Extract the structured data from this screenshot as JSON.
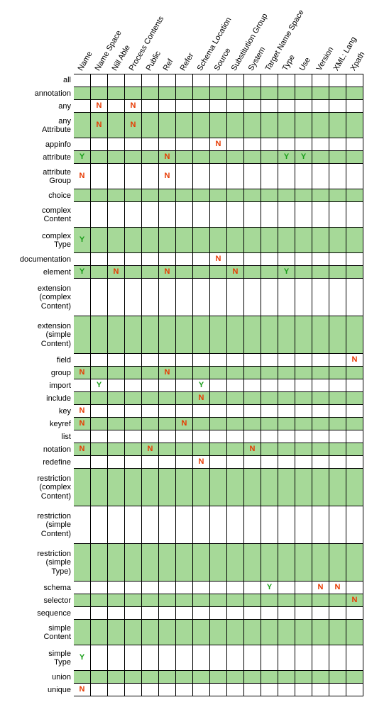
{
  "chart_data": {
    "type": "table",
    "title": "",
    "columns": [
      "Name",
      "Name Space",
      "Nill Able",
      "Process Contents",
      "Public",
      "Ref",
      "Refer",
      "Schema Location",
      "Source",
      "Substitution Group",
      "System",
      "Target Name Space",
      "Type",
      "Use",
      "Version",
      "XML: Lang",
      "Xpath"
    ],
    "rows": [
      {
        "label": "all",
        "shaded": false,
        "cells": [
          "",
          "",
          "",
          "",
          "",
          "",
          "",
          "",
          "",
          "",
          "",
          "",
          "",
          "",
          "",
          "",
          ""
        ]
      },
      {
        "label": "annotation",
        "shaded": true,
        "cells": [
          "",
          "",
          "",
          "",
          "",
          "",
          "",
          "",
          "",
          "",
          "",
          "",
          "",
          "",
          "",
          "",
          ""
        ]
      },
      {
        "label": "any",
        "shaded": false,
        "cells": [
          "",
          "N",
          "",
          "N",
          "",
          "",
          "",
          "",
          "",
          "",
          "",
          "",
          "",
          "",
          "",
          "",
          ""
        ]
      },
      {
        "label": "any\nAttribute",
        "shaded": true,
        "lines": 2,
        "cells": [
          "",
          "N",
          "",
          "N",
          "",
          "",
          "",
          "",
          "",
          "",
          "",
          "",
          "",
          "",
          "",
          "",
          ""
        ]
      },
      {
        "label": "appinfo",
        "shaded": false,
        "cells": [
          "",
          "",
          "",
          "",
          "",
          "",
          "",
          "",
          "N",
          "",
          "",
          "",
          "",
          "",
          "",
          "",
          ""
        ]
      },
      {
        "label": "attribute",
        "shaded": true,
        "cells": [
          "Y",
          "",
          "",
          "",
          "",
          "N",
          "",
          "",
          "",
          "",
          "",
          "",
          "Y",
          "Y",
          "",
          "",
          ""
        ]
      },
      {
        "label": "attribute\nGroup",
        "shaded": false,
        "lines": 2,
        "cells": [
          "N",
          "",
          "",
          "",
          "",
          "N",
          "",
          "",
          "",
          "",
          "",
          "",
          "",
          "",
          "",
          "",
          ""
        ]
      },
      {
        "label": "choice",
        "shaded": true,
        "cells": [
          "",
          "",
          "",
          "",
          "",
          "",
          "",
          "",
          "",
          "",
          "",
          "",
          "",
          "",
          "",
          "",
          ""
        ]
      },
      {
        "label": "complex\nContent",
        "shaded": false,
        "lines": 2,
        "cells": [
          "",
          "",
          "",
          "",
          "",
          "",
          "",
          "",
          "",
          "",
          "",
          "",
          "",
          "",
          "",
          "",
          ""
        ]
      },
      {
        "label": "complex\nType",
        "shaded": true,
        "lines": 2,
        "cells": [
          "Y",
          "",
          "",
          "",
          "",
          "",
          "",
          "",
          "",
          "",
          "",
          "",
          "",
          "",
          "",
          "",
          ""
        ]
      },
      {
        "label": "documentation",
        "shaded": false,
        "cells": [
          "",
          "",
          "",
          "",
          "",
          "",
          "",
          "",
          "N",
          "",
          "",
          "",
          "",
          "",
          "",
          "",
          ""
        ]
      },
      {
        "label": "element",
        "shaded": true,
        "cells": [
          "Y",
          "",
          "N",
          "",
          "",
          "N",
          "",
          "",
          "",
          "N",
          "",
          "",
          "Y",
          "",
          "",
          "",
          ""
        ]
      },
      {
        "label": "extension\n(complex\nContent)",
        "shaded": false,
        "lines": 3,
        "cells": [
          "",
          "",
          "",
          "",
          "",
          "",
          "",
          "",
          "",
          "",
          "",
          "",
          "",
          "",
          "",
          "",
          ""
        ]
      },
      {
        "label": "extension\n(simple\nContent)",
        "shaded": true,
        "lines": 3,
        "cells": [
          "",
          "",
          "",
          "",
          "",
          "",
          "",
          "",
          "",
          "",
          "",
          "",
          "",
          "",
          "",
          "",
          ""
        ]
      },
      {
        "label": "field",
        "shaded": false,
        "cells": [
          "",
          "",
          "",
          "",
          "",
          "",
          "",
          "",
          "",
          "",
          "",
          "",
          "",
          "",
          "",
          "",
          "N"
        ]
      },
      {
        "label": "group",
        "shaded": true,
        "cells": [
          "N",
          "",
          "",
          "",
          "",
          "N",
          "",
          "",
          "",
          "",
          "",
          "",
          "",
          "",
          "",
          "",
          ""
        ]
      },
      {
        "label": "import",
        "shaded": false,
        "cells": [
          "",
          "Y",
          "",
          "",
          "",
          "",
          "",
          "Y",
          "",
          "",
          "",
          "",
          "",
          "",
          "",
          "",
          ""
        ]
      },
      {
        "label": "include",
        "shaded": true,
        "cells": [
          "",
          "",
          "",
          "",
          "",
          "",
          "",
          "N",
          "",
          "",
          "",
          "",
          "",
          "",
          "",
          "",
          ""
        ]
      },
      {
        "label": "key",
        "shaded": false,
        "cells": [
          "N",
          "",
          "",
          "",
          "",
          "",
          "",
          "",
          "",
          "",
          "",
          "",
          "",
          "",
          "",
          "",
          ""
        ]
      },
      {
        "label": "keyref",
        "shaded": true,
        "cells": [
          "N",
          "",
          "",
          "",
          "",
          "",
          "N",
          "",
          "",
          "",
          "",
          "",
          "",
          "",
          "",
          "",
          ""
        ]
      },
      {
        "label": "list",
        "shaded": false,
        "cells": [
          "",
          "",
          "",
          "",
          "",
          "",
          "",
          "",
          "",
          "",
          "",
          "",
          "",
          "",
          "",
          "",
          ""
        ]
      },
      {
        "label": "notation",
        "shaded": true,
        "cells": [
          "N",
          "",
          "",
          "",
          "N",
          "",
          "",
          "",
          "",
          "",
          "N",
          "",
          "",
          "",
          "",
          "",
          ""
        ]
      },
      {
        "label": "redefine",
        "shaded": false,
        "cells": [
          "",
          "",
          "",
          "",
          "",
          "",
          "",
          "N",
          "",
          "",
          "",
          "",
          "",
          "",
          "",
          "",
          ""
        ]
      },
      {
        "label": "restriction\n(complex\nContent)",
        "shaded": true,
        "lines": 3,
        "cells": [
          "",
          "",
          "",
          "",
          "",
          "",
          "",
          "",
          "",
          "",
          "",
          "",
          "",
          "",
          "",
          "",
          ""
        ]
      },
      {
        "label": "restriction\n(simple\nContent)",
        "shaded": false,
        "lines": 3,
        "cells": [
          "",
          "",
          "",
          "",
          "",
          "",
          "",
          "",
          "",
          "",
          "",
          "",
          "",
          "",
          "",
          "",
          ""
        ]
      },
      {
        "label": "restriction\n(simple\nType)",
        "shaded": true,
        "lines": 3,
        "cells": [
          "",
          "",
          "",
          "",
          "",
          "",
          "",
          "",
          "",
          "",
          "",
          "",
          "",
          "",
          "",
          "",
          ""
        ]
      },
      {
        "label": "schema",
        "shaded": false,
        "cells": [
          "",
          "",
          "",
          "",
          "",
          "",
          "",
          "",
          "",
          "",
          "",
          "Y",
          "",
          "",
          "N",
          "N",
          ""
        ]
      },
      {
        "label": "selector",
        "shaded": true,
        "cells": [
          "",
          "",
          "",
          "",
          "",
          "",
          "",
          "",
          "",
          "",
          "",
          "",
          "",
          "",
          "",
          "",
          "N"
        ]
      },
      {
        "label": "sequence",
        "shaded": false,
        "cells": [
          "",
          "",
          "",
          "",
          "",
          "",
          "",
          "",
          "",
          "",
          "",
          "",
          "",
          "",
          "",
          "",
          ""
        ]
      },
      {
        "label": "simple\nContent",
        "shaded": true,
        "lines": 2,
        "cells": [
          "",
          "",
          "",
          "",
          "",
          "",
          "",
          "",
          "",
          "",
          "",
          "",
          "",
          "",
          "",
          "",
          ""
        ]
      },
      {
        "label": "simple\nType",
        "shaded": false,
        "lines": 2,
        "cells": [
          "Y",
          "",
          "",
          "",
          "",
          "",
          "",
          "",
          "",
          "",
          "",
          "",
          "",
          "",
          "",
          "",
          ""
        ]
      },
      {
        "label": "union",
        "shaded": true,
        "cells": [
          "",
          "",
          "",
          "",
          "",
          "",
          "",
          "",
          "",
          "",
          "",
          "",
          "",
          "",
          "",
          "",
          ""
        ]
      },
      {
        "label": "unique",
        "shaded": false,
        "cells": [
          "N",
          "",
          "",
          "",
          "",
          "",
          "",
          "",
          "",
          "",
          "",
          "",
          "",
          "",
          "",
          "",
          ""
        ]
      }
    ]
  }
}
